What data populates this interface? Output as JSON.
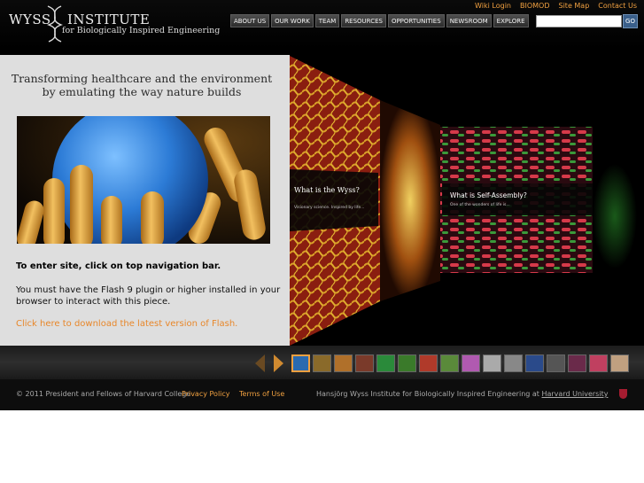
{
  "logo": {
    "word1": "WYSS",
    "word2": "INSTITUTE",
    "tagline": "for Biologically Inspired Engineering"
  },
  "util_links": [
    "Wiki Login",
    "BIOMOD",
    "Site Map",
    "Contact Us"
  ],
  "nav": [
    "ABOUT US",
    "OUR WORK",
    "TEAM",
    "RESOURCES",
    "OPPORTUNITIES",
    "NEWSROOM",
    "EXPLORE"
  ],
  "search": {
    "value": "",
    "go_label": "GO"
  },
  "panel": {
    "headline_line1": "Transforming healthcare and the environment",
    "headline_line2": "by emulating the way nature builds",
    "enter_text": "To enter site, click on top navigation bar.",
    "flash_msg": "You must have the Flash 9 plugin or higher installed in your browser to interact with this piece.",
    "flash_link": "Click here to download the latest version of Flash."
  },
  "showcase": {
    "card1_title": "What is the Wyss?",
    "card1_sub": "Visionary science. Inspired by life...",
    "card2_title": "What is Self-Assembly?",
    "card2_sub": "One of the wonders of life is..."
  },
  "thumbs": {
    "count": 16,
    "selected_index": 0,
    "colors": [
      "#2a6ab0",
      "#8a6a2a",
      "#b0702a",
      "#7a3a2a",
      "#2a8a3a",
      "#3a7a2a",
      "#b03a2a",
      "#5a8a3a",
      "#b05ab0",
      "#aaaaaa",
      "#888888",
      "#2a4a8a",
      "#555555",
      "#6a2a4a",
      "#c04060",
      "#c0a080"
    ]
  },
  "footer": {
    "copyright": "© 2011 President and Fellows of Harvard College",
    "privacy": "Privacy Policy",
    "terms": "Terms of Use",
    "wyss_text": "Hansjörg Wyss Institute for Biologically Inspired Engineering at",
    "harvard": "Harvard University"
  },
  "colors": {
    "accent": "#f0a040",
    "link_orange": "#e8872a",
    "panel_bg": "#dedede"
  }
}
